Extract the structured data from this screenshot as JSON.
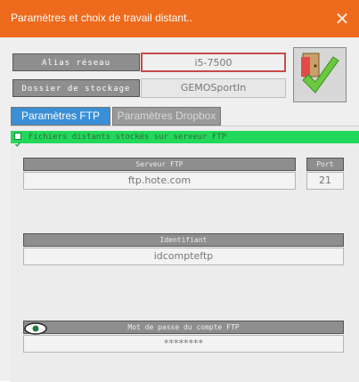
{
  "window": {
    "title": "Paramètres et choix de travail distant..",
    "close_symbol": "✕",
    "colors": {
      "title_bar": "#ee6a1c",
      "active_tab": "#3a8fd6",
      "green_bar": "#22d85a",
      "value_border": "#c64b4b"
    }
  },
  "top": {
    "alias_label": "Alias réseau",
    "alias_value": "i5-7500",
    "storage_label": "Dossier de stockage",
    "storage_value": "GEMOSportIn"
  },
  "confirm_button": {
    "icon": "door-checkmark-icon"
  },
  "tabs": [
    {
      "label": "Paramètres FTP"
    },
    {
      "label": "Paramètres Dropbox"
    }
  ],
  "ftp": {
    "remote_files_checked": true,
    "remote_files_label": "Fichiers distants stockés sur serveur FTP",
    "server_label": "Serveur FTP",
    "server_value": "ftp.hote.com",
    "port_label": "Port",
    "port_value": "21",
    "identifier_label": "Identifiant",
    "identifier_value": "idcompteftp",
    "password_label": "Mot de passe du compte FTP",
    "password_value": "********",
    "show_password_icon": "eye-icon"
  }
}
